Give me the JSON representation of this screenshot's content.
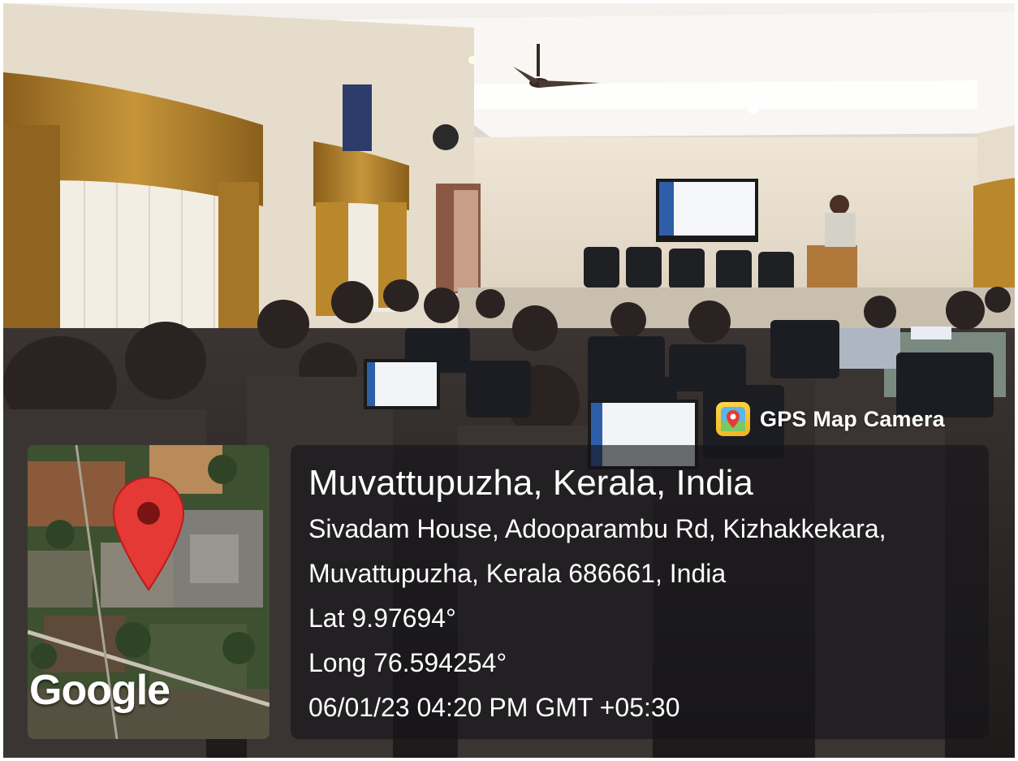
{
  "overlay": {
    "app_badge": "GPS Map Camera",
    "location_title": "Muvattupuzha, Kerala, India",
    "address_line_1": "Sivadam House, Adooparambu Rd, Kizhakkekara,",
    "address_line_2": "Muvattupuzha, Kerala 686661, India",
    "latitude": "Lat 9.97694°",
    "longitude": "Long 76.594254°",
    "datetime": "06/01/23 04:20 PM GMT +05:30",
    "map_logo": "Google"
  },
  "colors": {
    "panel": "#141418",
    "pin": "#e53935",
    "pin_dot": "#7a1414",
    "badge": "#f2b01e",
    "wall": "#ece3d6",
    "curtain": "#b9872c"
  }
}
